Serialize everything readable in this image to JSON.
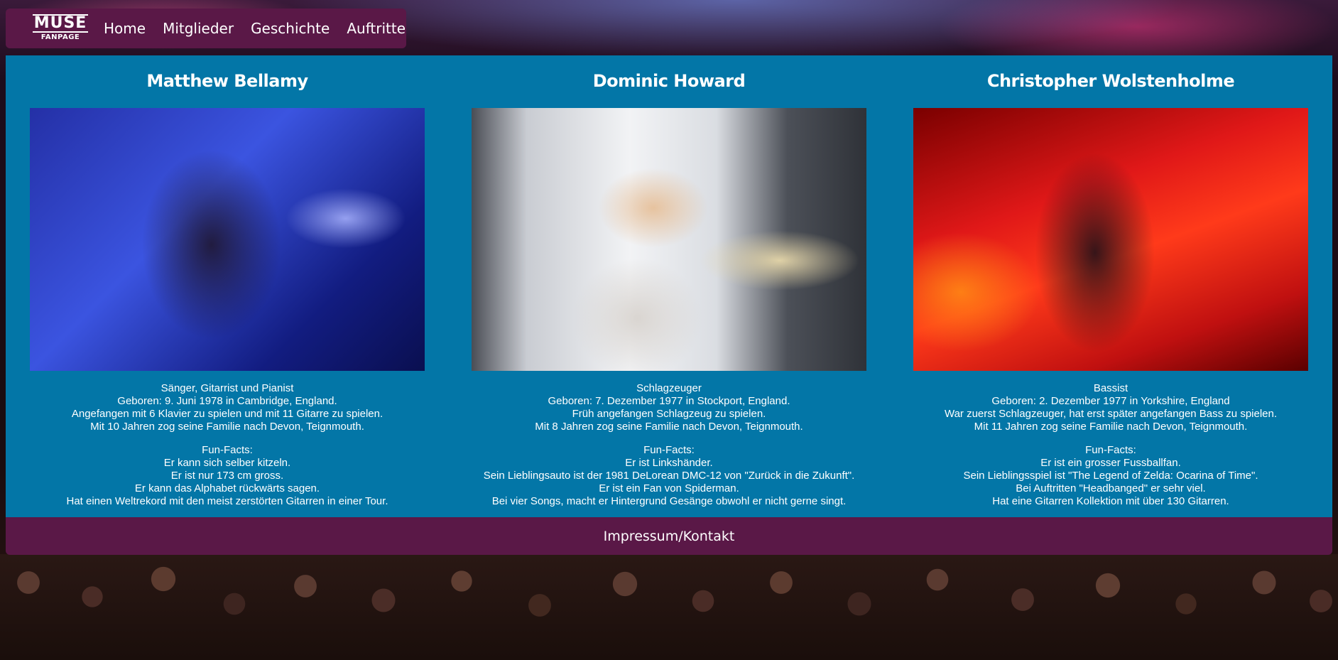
{
  "nav": {
    "logo_main": "MUSE",
    "logo_sub": "FANPAGE",
    "links": [
      "Home",
      "Mitglieder",
      "Geschichte",
      "Auftritte"
    ]
  },
  "members": [
    {
      "name": "Matthew Bellamy",
      "facts": [
        "Sänger, Gitarrist und Pianist",
        "Geboren: 9. Juni 1978 in Cambridge, England.",
        "Angefangen mit 6 Klavier zu spielen und mit 11 Gitarre zu spielen.",
        "Mit 10 Jahren zog seine Familie nach Devon, Teignmouth."
      ],
      "funfacts_title": "Fun-Facts:",
      "funfacts": [
        "Er kann sich selber kitzeln.",
        "Er ist nur 173 cm gross.",
        "Er kann das Alphabet rückwärts sagen.",
        "Hat einen Weltrekord mit den meist zerstörten Gitarren in einer Tour."
      ]
    },
    {
      "name": "Dominic Howard",
      "facts": [
        "Schlagzeuger",
        "Geboren: 7. Dezember 1977 in Stockport, England.",
        "Früh angefangen Schlagzeug zu spielen.",
        "Mit 8 Jahren zog seine Familie nach Devon, Teignmouth."
      ],
      "funfacts_title": "Fun-Facts:",
      "funfacts": [
        "Er ist Linkshänder.",
        "Sein Lieblingsauto ist der 1981 DeLorean DMC-12 von \"Zurück in die Zukunft\".",
        "Er ist ein Fan von Spiderman.",
        "Bei vier Songs, macht er Hintergrund Gesänge obwohl er nicht gerne singt."
      ]
    },
    {
      "name": "Christopher Wolstenholme",
      "facts": [
        "Bassist",
        "Geboren: 2. Dezember 1977 in Yorkshire, England",
        "War zuerst Schlagzeuger, hat erst später angefangen Bass zu spielen.",
        "Mit 11 Jahren zog seine Familie nach Devon, Teignmouth."
      ],
      "funfacts_title": "Fun-Facts:",
      "funfacts": [
        "Er ist ein grosser Fussballfan.",
        "Sein Lieblingsspiel ist \"The Legend of Zelda: Ocarina of Time\".",
        "Bei Auftritten \"Headbanged\" er sehr viel.",
        "Hat eine Gitarren Kollektion mit über 130 Gitarren."
      ]
    }
  ],
  "footer": {
    "link": "Impressum/Kontakt"
  },
  "colors": {
    "nav_bg": "#5a1847",
    "content_bg": "#0376a7",
    "text": "#ffffff"
  }
}
